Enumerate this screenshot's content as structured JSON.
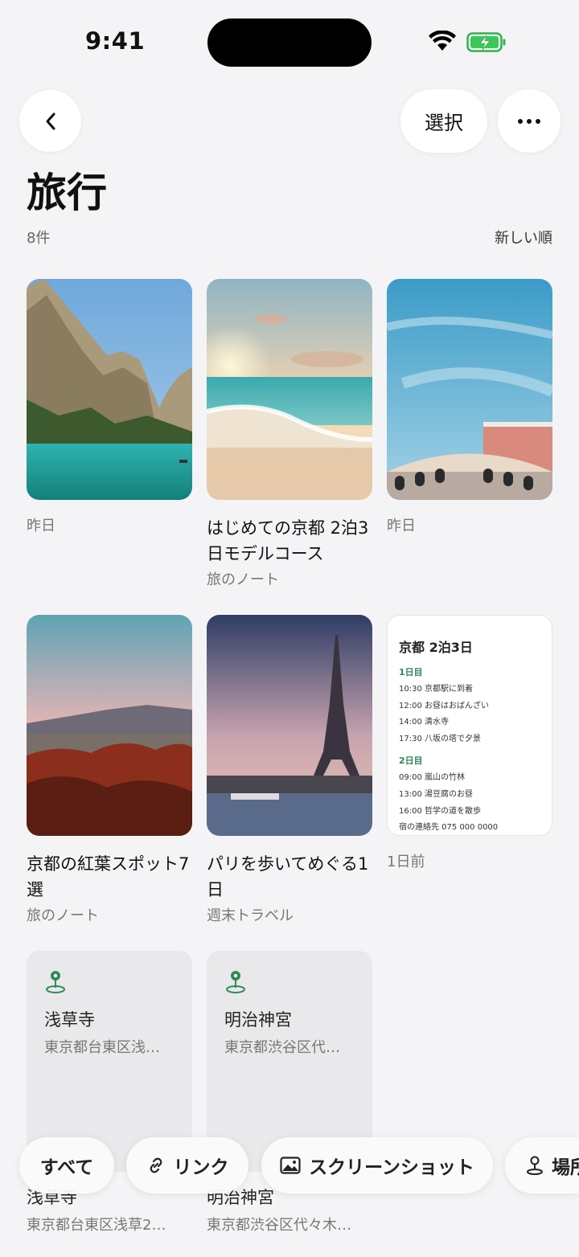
{
  "status": {
    "time": "9:41"
  },
  "header": {
    "select_label": "選択",
    "title": "旅行",
    "count": "8件",
    "sort": "新しい順"
  },
  "cards": [
    {
      "date": "昨日"
    },
    {
      "title": "はじめての京都 2泊3日モデルコース",
      "source": "旅のノート"
    },
    {
      "date": "昨日"
    },
    {
      "title": "京都の紅葉スポット7選",
      "source": "旅のノート"
    },
    {
      "title": "パリを歩いてめぐる1日",
      "source": "週末トラベル"
    },
    {
      "date": "1日前"
    }
  ],
  "note": {
    "title": "京都 2泊3日",
    "day1": "1日目",
    "day1_items": [
      "10:30 京都駅に到着",
      "12:00 お昼はおばんざい",
      "14:00 清水寺",
      "17:30 八坂の塔で夕景"
    ],
    "day2": "2日目",
    "day2_items": [
      "09:00 嵐山の竹林",
      "13:00 湯豆腐のお昼",
      "16:00 哲学の道を散歩",
      "宿の連絡先 075 000 0000"
    ]
  },
  "places": [
    {
      "name": "浅草寺",
      "address": "東京都台東区浅…",
      "below_name": "浅草寺",
      "below_address": "東京都台東区浅草2…"
    },
    {
      "name": "明治神宮",
      "address": "東京都渋谷区代…",
      "below_name": "明治神宮",
      "below_address": "東京都渋谷区代々木…"
    }
  ],
  "filters": [
    {
      "label": "すべて",
      "icon": "none"
    },
    {
      "label": "リンク",
      "icon": "link-icon"
    },
    {
      "label": "スクリーンショット",
      "icon": "image-icon"
    },
    {
      "label": "場所",
      "icon": "location-icon"
    }
  ],
  "colors": {
    "accent_green": "#2f8a56",
    "background": "#f4f4f6"
  }
}
